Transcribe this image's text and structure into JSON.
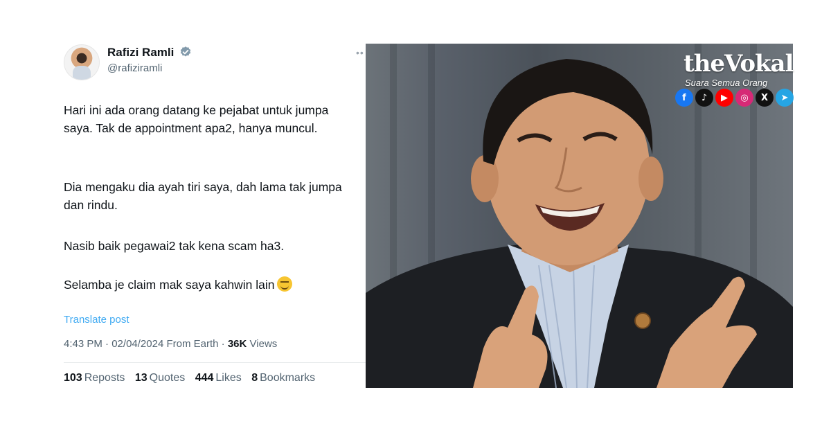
{
  "tweet": {
    "author_name": "Rafizi Ramli",
    "author_handle": "@rafiziramli",
    "paragraphs": [
      "Hari ini ada orang datang ke pejabat untuk jumpa saya. Tak de appointment apa2, hanya muncul.",
      "Dia mengaku dia ayah tiri saya, dah lama tak jumpa dan rindu.",
      "Nasib baik pegawai2 tak kena scam ha3.",
      "Selamba je claim mak saya kahwin lain"
    ],
    "emoji_icon": "rolling-on-floor-laughing-emoji",
    "translate_label": "Translate post",
    "time": "4:43 PM",
    "date": "02/04/2024",
    "source": "From Earth",
    "views_count": "36K",
    "views_label": "Views",
    "stats": {
      "reposts_count": "103",
      "reposts_label": "Reposts",
      "quotes_count": "13",
      "quotes_label": "Quotes",
      "likes_count": "444",
      "likes_label": "Likes",
      "bookmarks_count": "8",
      "bookmarks_label": "Bookmarks"
    },
    "colors": {
      "link": "#1d9bf0",
      "verified": "#829aab",
      "text": "#0f1419",
      "muted": "#536471"
    }
  },
  "brand": {
    "logo": "theVokal",
    "tagline": "Suara Semua Orang",
    "socials": [
      {
        "name": "facebook-icon",
        "glyph": "f",
        "color": "#1877f2"
      },
      {
        "name": "tiktok-icon",
        "glyph": "♪",
        "color": "#111111"
      },
      {
        "name": "youtube-icon",
        "glyph": "▶",
        "color": "#ff0000"
      },
      {
        "name": "instagram-icon",
        "glyph": "◎",
        "color": "#d62976"
      },
      {
        "name": "x-icon",
        "glyph": "𝕏",
        "color": "#111111"
      },
      {
        "name": "telegram-icon",
        "glyph": "➤",
        "color": "#26a5e4"
      }
    ]
  }
}
